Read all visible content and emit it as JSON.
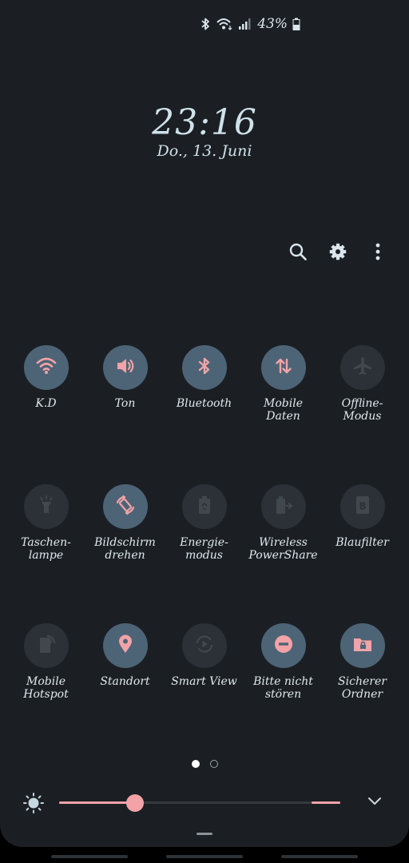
{
  "status": {
    "battery_percent": "43%",
    "icons": [
      "bluetooth-icon",
      "wifi-icon",
      "signal-icon",
      "battery-icon"
    ]
  },
  "lock": {
    "time": "23:16",
    "date": "Do., 13. Juni"
  },
  "actions": [
    "search-icon",
    "gear-icon",
    "more-vert-icon"
  ],
  "tiles": [
    [
      {
        "label": "K.D",
        "icon": "wifi-icon",
        "active": true
      },
      {
        "label": "Ton",
        "icon": "volume-icon",
        "active": true
      },
      {
        "label": "Bluetooth",
        "icon": "bluetooth-icon",
        "active": true
      },
      {
        "label": "Mobile\nDaten",
        "icon": "mobile-data-icon",
        "active": true
      },
      {
        "label": "Offline-\nModus",
        "icon": "airplane-icon",
        "active": false
      }
    ],
    [
      {
        "label": "Taschen-\nlampe",
        "icon": "flashlight-icon",
        "active": false
      },
      {
        "label": "Bildschirm\ndrehen",
        "icon": "rotate-icon",
        "active": true
      },
      {
        "label": "Energie-\nmodus",
        "icon": "battery-saver-icon",
        "active": false
      },
      {
        "label": "Wireless\nPowerShare",
        "icon": "powershare-icon",
        "active": false
      },
      {
        "label": "Blaufilter",
        "icon": "blue-light-filter-icon",
        "active": false
      }
    ],
    [
      {
        "label": "Mobile\nHotspot",
        "icon": "hotspot-icon",
        "active": false
      },
      {
        "label": "Standort",
        "icon": "location-icon",
        "active": true
      },
      {
        "label": "Smart View",
        "icon": "smart-view-icon",
        "active": false
      },
      {
        "label": "Bitte nicht\nstören",
        "icon": "do-not-disturb-icon",
        "active": true
      },
      {
        "label": "Sicherer\nOrdner",
        "icon": "secure-folder-icon",
        "active": true
      }
    ]
  ],
  "pager": {
    "pages": 2,
    "current": 0
  },
  "brightness": {
    "level": 0.27,
    "icon": "sun-icon"
  },
  "colors": {
    "panel": "#1b1f24",
    "tile_on": "#4d6476",
    "tile_off": "#2b3137",
    "accent": "#f3a2a7",
    "icon_on": "#f2a3a8",
    "icon_off": "#40474e",
    "text": "#cfe2ea"
  }
}
